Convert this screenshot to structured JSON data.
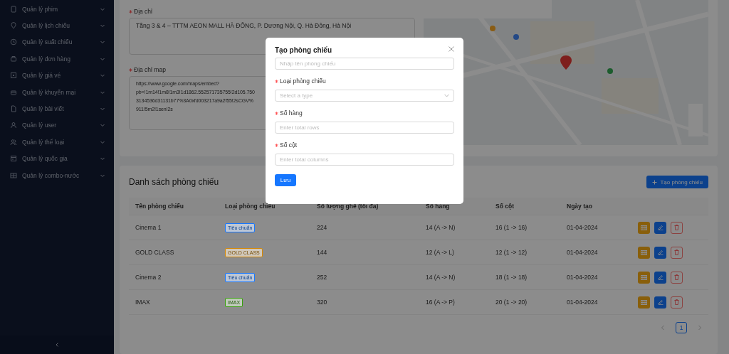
{
  "sidebar": {
    "items": [
      {
        "label": "Quản lý phim",
        "expanded": false
      },
      {
        "label": "Quản lý lịch chiếu",
        "expanded": false
      },
      {
        "label": "Quản lý suất chiếu",
        "expanded": false
      },
      {
        "label": "Quản lý đơn hàng",
        "expanded": false
      },
      {
        "label": "Quản lý giá vé",
        "expanded": false
      },
      {
        "label": "Quản lý khuyến mại",
        "expanded": false
      },
      {
        "label": "Quản lý bài viết",
        "expanded": false
      },
      {
        "label": "Quản lý user",
        "expanded": false
      },
      {
        "label": "Quản lý thể loại",
        "expanded": false
      },
      {
        "label": "Quản lý quốc gia",
        "expanded": false
      },
      {
        "label": "Quản lý combo-nước",
        "expanded": false
      }
    ]
  },
  "address_form": {
    "fields": [
      {
        "label": "Địa chỉ",
        "required": true,
        "lines": [
          "Tầng 3 & 4 – TTTM AEON MALL HÀ ĐÔNG, P. Dương Nội, Q. Hà Đông, Hà Nội"
        ]
      },
      {
        "label": "Địa chỉ map",
        "required": true,
        "lines": [
          "https://www.google.com/maps/embed?",
          "pb=!1m14!1m8!1m3!1d1862.552571735755!2d105.750",
          "3134536d31131b77%3A0xfd003217a9a2f55!2sCGV%",
          "911!5m2!1sen!2s"
        ]
      }
    ]
  },
  "room_list": {
    "title": "Danh sách phòng chiếu",
    "create_button": "Tạo phòng chiếu",
    "table": {
      "columns": [
        "Tên phòng chiếu",
        "Loại phòng chiếu",
        "Số lượng ghế (tối đa)",
        "Số hàng",
        "Số cột",
        "Ngày tạo"
      ],
      "rows": [
        {
          "name": "Cinema 1",
          "type": {
            "label": "Tiêu chuẩn",
            "color": "#1677ff"
          },
          "seats": "224",
          "rows": "14 (A -> N)",
          "cols": "16 (1 -> 16)",
          "date": "01-04-2024"
        },
        {
          "name": "GOLD CLASS",
          "type": {
            "label": "GOLD CLASS",
            "color": "#d48806"
          },
          "seats": "144",
          "rows": "12 (A -> L)",
          "cols": "12 (1 -> 12)",
          "date": "01-04-2024"
        },
        {
          "name": "Cinema 2",
          "type": {
            "label": "Tiêu chuẩn",
            "color": "#1677ff"
          },
          "seats": "252",
          "rows": "14 (A -> N)",
          "cols": "18 (1 -> 18)",
          "date": "01-04-2024"
        },
        {
          "name": "IMAX",
          "type": {
            "label": "IMAX",
            "color": "#389e0d"
          },
          "seats": "320",
          "rows": "16 (A -> P)",
          "cols": "20 (1 -> 20)",
          "date": "01-04-2024"
        }
      ]
    },
    "pagination": {
      "pages": [
        {
          "label": "1",
          "selected": true
        }
      ]
    }
  },
  "modal": {
    "title": "Tạo phòng chiếu",
    "fields": [
      {
        "kind": "input",
        "required": false,
        "placeholder": "Nhập tên phòng chiếu"
      },
      {
        "kind": "select",
        "label": "Loại phòng chiếu",
        "required": true,
        "placeholder": "Select a type"
      },
      {
        "kind": "input",
        "label": "Số hàng",
        "required": true,
        "placeholder": "Enter total rows"
      },
      {
        "kind": "input",
        "label": "Số cột",
        "required": true,
        "placeholder": "Enter total columns"
      }
    ],
    "submit": "Lưu"
  }
}
